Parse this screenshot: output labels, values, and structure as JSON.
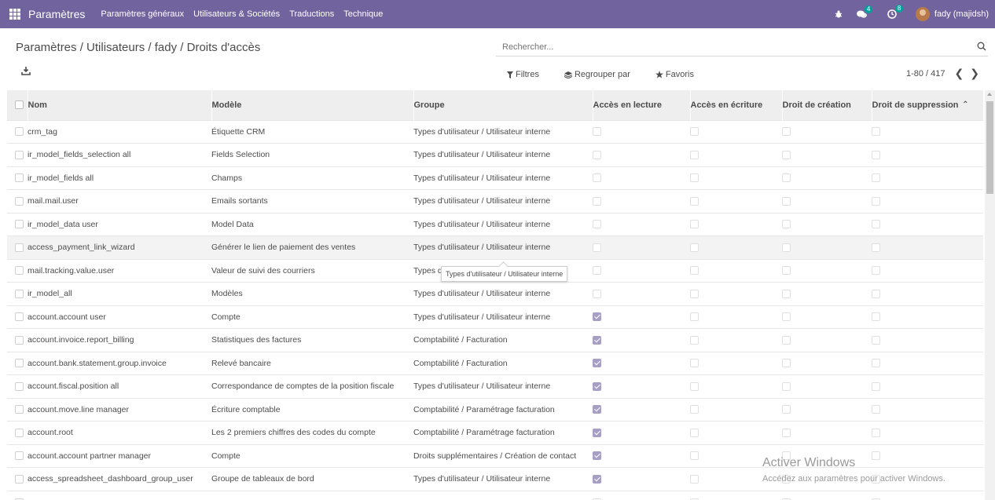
{
  "navbar": {
    "app_name": "Paramètres",
    "menu": [
      "Paramètres généraux",
      "Utilisateurs & Sociétés",
      "Traductions",
      "Technique"
    ],
    "messages_count": "4",
    "activities_count": "8",
    "user_name": "fady (majidsh)",
    "accent_color": "#71639e"
  },
  "breadcrumb": [
    "Paramètres",
    "Utilisateurs",
    "fady",
    "Droits d'accès"
  ],
  "search": {
    "placeholder": "Rechercher..."
  },
  "filters": {
    "filters_label": "Filtres",
    "group_label": "Regrouper par",
    "favorites_label": "Favoris"
  },
  "pager": {
    "value": "1-80 / 417"
  },
  "table": {
    "headers": [
      "Nom",
      "Modèle",
      "Groupe",
      "Accès en lecture",
      "Accès en écriture",
      "Droit de création",
      "Droit de suppression"
    ],
    "rows": [
      {
        "name": "crm_tag",
        "model": "Étiquette CRM",
        "group": "Types d'utilisateur / Utilisateur interne",
        "read": false,
        "write": false,
        "create": false,
        "unlink": false
      },
      {
        "name": "ir_model_fields_selection all",
        "model": "Fields Selection",
        "group": "Types d'utilisateur / Utilisateur interne",
        "read": false,
        "write": false,
        "create": false,
        "unlink": false
      },
      {
        "name": "ir_model_fields all",
        "model": "Champs",
        "group": "Types d'utilisateur / Utilisateur interne",
        "read": false,
        "write": false,
        "create": false,
        "unlink": false
      },
      {
        "name": "mail.mail.user",
        "model": "Emails sortants",
        "group": "Types d'utilisateur / Utilisateur interne",
        "read": false,
        "write": false,
        "create": false,
        "unlink": false
      },
      {
        "name": "ir_model_data user",
        "model": "Model Data",
        "group": "Types d'utilisateur / Utilisateur interne",
        "read": false,
        "write": false,
        "create": false,
        "unlink": false
      },
      {
        "name": "access_payment_link_wizard",
        "model": "Générer le lien de paiement des ventes",
        "group": "Types d'utilisateur / Utilisateur interne",
        "read": false,
        "write": false,
        "create": false,
        "unlink": false
      },
      {
        "name": "mail.tracking.value.user",
        "model": "Valeur de suivi des courriers",
        "group": "Types d'utilisateur / Utilisateur interne",
        "read": false,
        "write": false,
        "create": false,
        "unlink": false
      },
      {
        "name": "ir_model_all",
        "model": "Modèles",
        "group": "Types d'utilisateur / Utilisateur interne",
        "read": false,
        "write": false,
        "create": false,
        "unlink": false
      },
      {
        "name": "account.account user",
        "model": "Compte",
        "group": "Types d'utilisateur / Utilisateur interne",
        "read": true,
        "write": false,
        "create": false,
        "unlink": false
      },
      {
        "name": "account.invoice.report_billing",
        "model": "Statistiques des factures",
        "group": "Comptabilité / Facturation",
        "read": true,
        "write": false,
        "create": false,
        "unlink": false
      },
      {
        "name": "account.bank.statement.group.invoice",
        "model": "Relevé bancaire",
        "group": "Comptabilité / Facturation",
        "read": true,
        "write": false,
        "create": false,
        "unlink": false
      },
      {
        "name": "account.fiscal.position all",
        "model": "Correspondance de comptes de la position fiscale",
        "group": "Types d'utilisateur / Utilisateur interne",
        "read": true,
        "write": false,
        "create": false,
        "unlink": false
      },
      {
        "name": "account.move.line manager",
        "model": "Écriture comptable",
        "group": "Comptabilité / Paramétrage facturation",
        "read": true,
        "write": false,
        "create": false,
        "unlink": false
      },
      {
        "name": "account.root",
        "model": "Les 2 premiers chiffres des codes du compte",
        "group": "Comptabilité / Paramétrage facturation",
        "read": true,
        "write": false,
        "create": false,
        "unlink": false
      },
      {
        "name": "account.account partner manager",
        "model": "Compte",
        "group": "Droits supplémentaires / Création de contact",
        "read": true,
        "write": false,
        "create": false,
        "unlink": false
      },
      {
        "name": "access_spreadsheet_dashboard_group_user",
        "model": "Groupe de tableaux de bord",
        "group": "Types d'utilisateur / Utilisateur interne",
        "read": true,
        "write": false,
        "create": false,
        "unlink": false
      },
      {
        "name": "",
        "model": "",
        "group": "",
        "read": false,
        "write": false,
        "create": false,
        "unlink": false
      }
    ]
  },
  "tooltip": {
    "text": "Types d'utilisateur / Utilisateur interne"
  },
  "watermark": {
    "title": "Activer Windows",
    "subtitle": "Accédez aux paramètres pour activer Windows."
  }
}
